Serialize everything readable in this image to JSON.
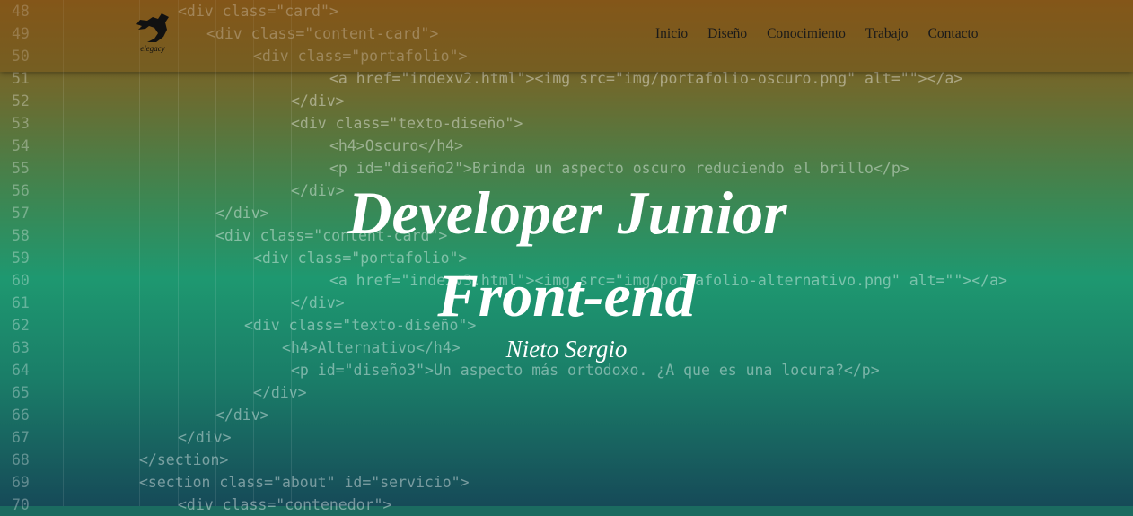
{
  "header": {
    "logo_text": "elegacy",
    "nav": [
      "Inicio",
      "Diseño",
      "Conocimiento",
      "Trabajo",
      "Contacto"
    ]
  },
  "hero": {
    "title_line1": "Developer Junior",
    "title_line2": "Front-end",
    "subtitle": "Nieto Sergio"
  },
  "code_lines": [
    {
      "n": "48",
      "t": "<div class=\"card\">"
    },
    {
      "n": "49",
      "t": "<div class=\"content-card\">"
    },
    {
      "n": "50",
      "t": "<div class=\"portafolio\">"
    },
    {
      "n": "51",
      "t": "<a href=\"indexv2.html\"><img src=\"img/portafolio-oscuro.png\" alt=\"\"></a>"
    },
    {
      "n": "52",
      "t": "</div>"
    },
    {
      "n": "53",
      "t": "<div class=\"texto-diseño\">"
    },
    {
      "n": "54",
      "t": "<h4>Oscuro</h4>"
    },
    {
      "n": "55",
      "t": "<p id=\"diseño2\">Brinda un aspecto oscuro reduciendo el brillo</p>"
    },
    {
      "n": "56",
      "t": "</div>"
    },
    {
      "n": "57",
      "t": "</div>"
    },
    {
      "n": "58",
      "t": "<div class=\"content-card\">"
    },
    {
      "n": "59",
      "t": "<div class=\"portafolio\">"
    },
    {
      "n": "60",
      "t": "<a href=\"indexv3.html\"><img src=\"img/portafolio-alternativo.png\" alt=\"\"></a>"
    },
    {
      "n": "61",
      "t": "</div>"
    },
    {
      "n": "62",
      "t": "<div class=\"texto-diseño\">"
    },
    {
      "n": "63",
      "t": "<h4>Alternativo</h4>"
    },
    {
      "n": "64",
      "t": "<p id=\"diseño3\">Un aspecto más ortodoxo. ¿A que es una locura?</p>"
    },
    {
      "n": "65",
      "t": "</div>"
    },
    {
      "n": "66",
      "t": "</div>"
    },
    {
      "n": "67",
      "t": "</div>"
    },
    {
      "n": "68",
      "t": "</section>"
    },
    {
      "n": "69",
      "t": "<section class=\"about\" id=\"servicio\">"
    },
    {
      "n": "70",
      "t": "<div class=\"contenedor\">"
    }
  ]
}
